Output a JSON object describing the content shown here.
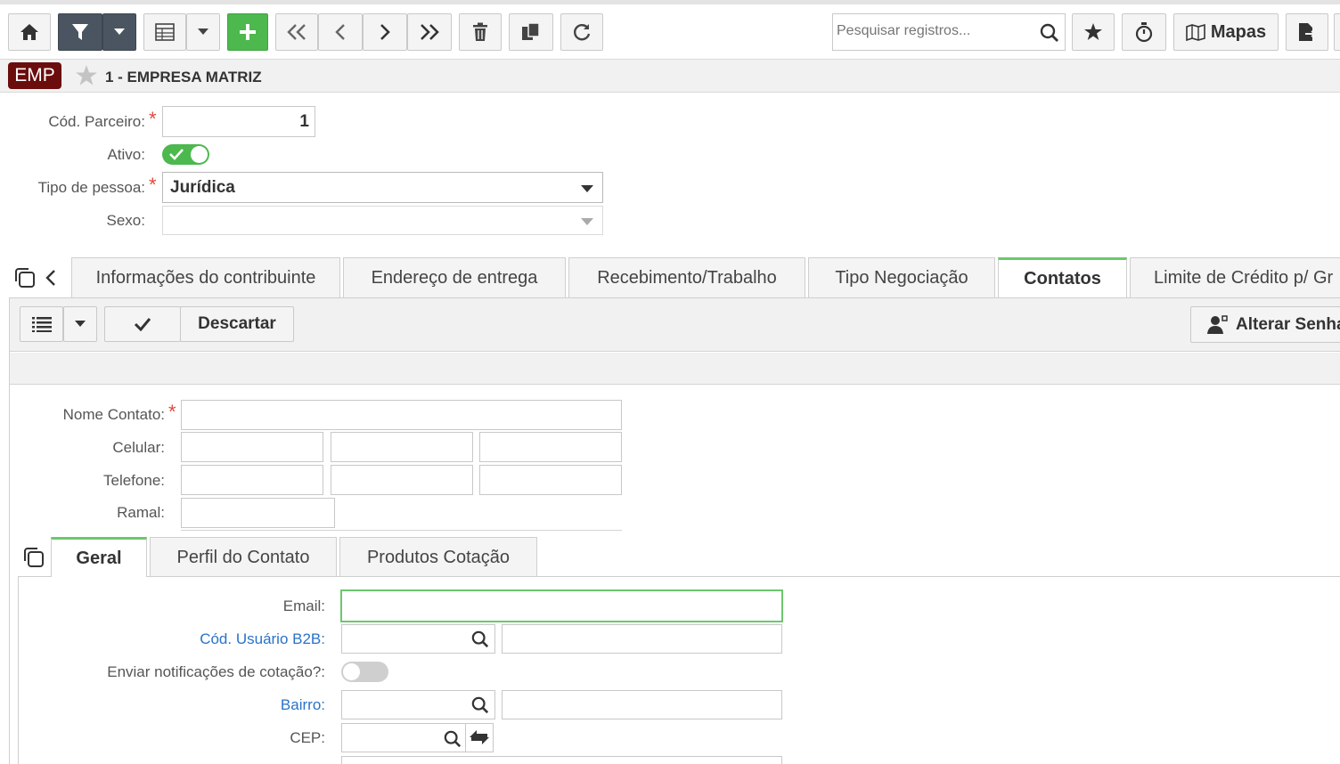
{
  "toolbar": {
    "search_placeholder": "Pesquisar registros...",
    "maps_label": "Mapas"
  },
  "record": {
    "badge": "EMP",
    "title": "1 - EMPRESA MATRIZ",
    "badge_color": "#6b0d0d"
  },
  "main_form": {
    "cod_parceiro_label": "Cód. Parceiro:",
    "cod_parceiro_value": "1",
    "ativo_label": "Ativo:",
    "tipo_pessoa_label": "Tipo de pessoa:",
    "tipo_pessoa_value": "Jurídica",
    "sexo_label": "Sexo:"
  },
  "tabs": [
    {
      "label": "Informações do contribuinte"
    },
    {
      "label": "Endereço de entrega"
    },
    {
      "label": "Recebimento/Trabalho"
    },
    {
      "label": "Tipo Negociação"
    },
    {
      "label": "Contatos"
    },
    {
      "label": "Limite de Crédito p/ Gr"
    }
  ],
  "contacts_toolbar": {
    "discard_label": "Descartar",
    "change_password_label": "Alterar Senha"
  },
  "contact_form": {
    "nome_label": "Nome Contato:",
    "celular_label": "Celular:",
    "telefone_label": "Telefone:",
    "ramal_label": "Ramal:"
  },
  "subtabs": [
    {
      "label": "Geral"
    },
    {
      "label": "Perfil do Contato"
    },
    {
      "label": "Produtos Cotação"
    }
  ],
  "general": {
    "email_label": "Email:",
    "cod_usuario_label": "Cód. Usuário B2B:",
    "notif_label": "Enviar notificações de cotação?:",
    "bairro_label": "Bairro:",
    "cep_label": "CEP:"
  },
  "colors": {
    "accent_green": "#4cb84e",
    "link_blue": "#2a72c9",
    "toolbar_dark": "#4a5561"
  }
}
